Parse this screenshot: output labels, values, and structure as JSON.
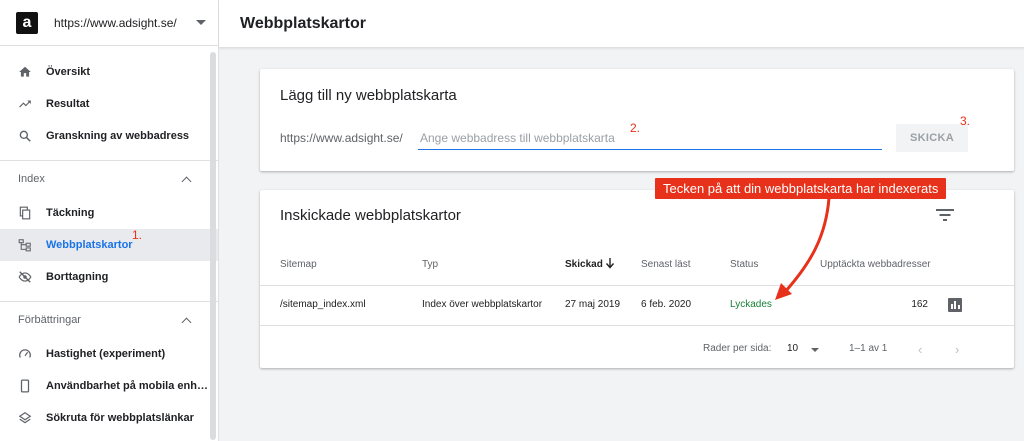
{
  "property": {
    "url": "https://www.adsight.se/",
    "logo_letter": "a"
  },
  "header": {
    "title": "Webbplatskartor"
  },
  "sidebar": {
    "top_items": [
      {
        "label": "Översikt",
        "icon": "home-icon"
      },
      {
        "label": "Resultat",
        "icon": "trending-up-icon"
      },
      {
        "label": "Granskning av webbadress",
        "icon": "search-icon"
      }
    ],
    "index_section": {
      "title": "Index",
      "items": [
        {
          "label": "Täckning",
          "icon": "coverage-icon"
        },
        {
          "label": "Webbplatskartor",
          "icon": "sitemap-icon",
          "active": true
        },
        {
          "label": "Borttagning",
          "icon": "eye-off-icon"
        }
      ]
    },
    "enhancements_section": {
      "title": "Förbättringar",
      "items": [
        {
          "label": "Hastighet (experiment)",
          "icon": "speed-icon"
        },
        {
          "label": "Användbarhet på mobila enh…",
          "icon": "mobile-icon"
        },
        {
          "label": "Sökruta för webbplatslänkar",
          "icon": "layers-icon"
        }
      ]
    }
  },
  "add_card": {
    "title": "Lägg till ny webbplatskarta",
    "prefix": "https://www.adsight.se/",
    "input_placeholder": "Ange webbadress till webbplatskarta",
    "input_value": "",
    "submit_label": "SKICKA"
  },
  "submitted_card": {
    "title": "Inskickade webbplatskartor",
    "columns": [
      "Sitemap",
      "Typ",
      "Skickad",
      "Senast läst",
      "Status",
      "Upptäckta webbadresser"
    ],
    "sorted_column": "Skickad",
    "rows": [
      {
        "sitemap": "/sitemap_index.xml",
        "type": "Index över webbplatskartor",
        "submitted": "27 maj 2019",
        "last_read": "6 feb. 2020",
        "status": "Lyckades",
        "discovered": "162"
      }
    ],
    "pagination": {
      "rows_per_page_label": "Rader per sida:",
      "rows_per_page": "10",
      "range": "1–1 av 1"
    }
  },
  "annotations": {
    "step1": "1.",
    "step2": "2.",
    "step3": "3.",
    "callout": "Tecken på att din webbplatskarta har indexerats"
  },
  "colors": {
    "accent": "#1a73e8",
    "success": "#188038",
    "annotation": "#e8311a"
  }
}
